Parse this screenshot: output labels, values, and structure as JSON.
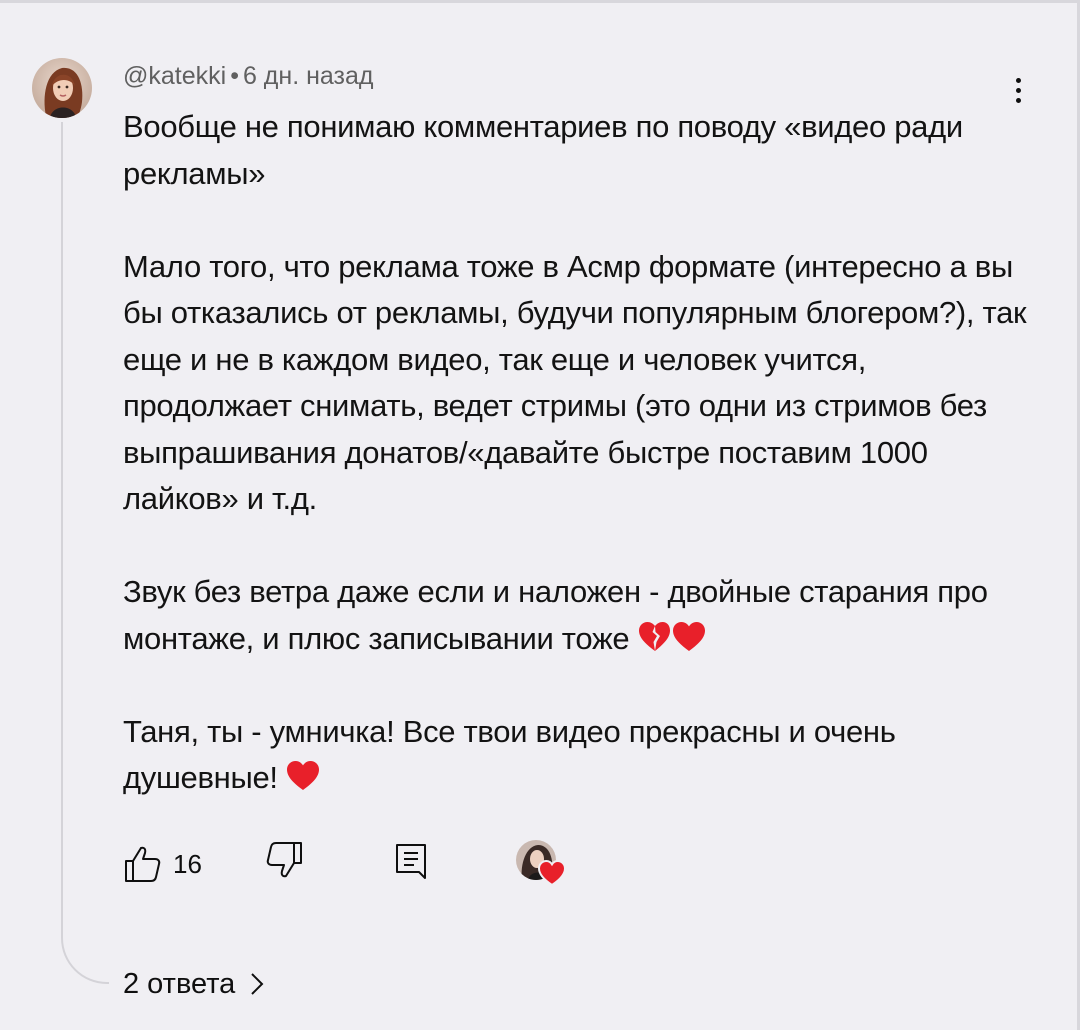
{
  "comment": {
    "author": "@katekki",
    "separator": "•",
    "time": "6 дн. назад",
    "paragraphs": [
      "Вообще не понимаю комментариев по поводу «видео ради рекламы»",
      "Мало того, что реклама тоже в Асмр формате (интересно а вы бы отказались от рекламы, будучи популярным блогером?), так еще и не в каждом видео, так еще и человек учится, продолжает снимать, ведет стримы (это одни из стримов без выпрашивания донатов/«давайте быстре поставим 1000 лайков» и т.д.",
      "Звук без ветра даже если и наложен - двойные старания про монтаже, и плюс записывании тоже",
      "Таня, ты - умничка! Все твои видео прекрасны и очень душевные!"
    ],
    "emoji": {
      "p3": [
        "broken-heart-icon",
        "red-heart-icon"
      ],
      "p4": [
        "red-heart-icon"
      ]
    }
  },
  "actions": {
    "like_count": "16",
    "like_icon": "thumb-up-icon",
    "dislike_icon": "thumb-down-icon",
    "reply_icon": "reply-icon",
    "creator_heart": "creator-heart-icon"
  },
  "replies": {
    "label": "2 ответа",
    "icon": "chevron-right-icon"
  },
  "colors": {
    "background": "#f0eff3",
    "text": "#131313",
    "meta_text": "#606060",
    "heart": "#e8202a",
    "thread_line": "#d4d3d8"
  }
}
